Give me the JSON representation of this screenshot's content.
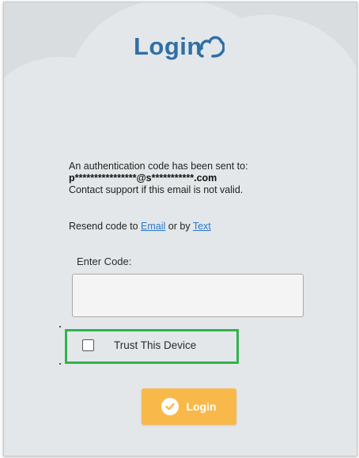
{
  "logo": {
    "text": "Login"
  },
  "message": {
    "line1": "An authentication code has been sent to:",
    "masked_email": "p****************@s***********.com",
    "line3": "Contact support if this email is not valid."
  },
  "resend": {
    "prefix": "Resend code to ",
    "email_link": "Email",
    "middle": " or by ",
    "text_link": "Text"
  },
  "code": {
    "label": "Enter Code:",
    "value": ""
  },
  "trust": {
    "label": "Trust This Device",
    "checked": false
  },
  "login_button": {
    "label": "Login",
    "icon": "check-circle-icon"
  },
  "colors": {
    "background": "#d9dde0",
    "logo": "#2f6fa8",
    "link": "#2a78c9",
    "highlight": "#2fb34f",
    "button": "#f9b94a"
  }
}
